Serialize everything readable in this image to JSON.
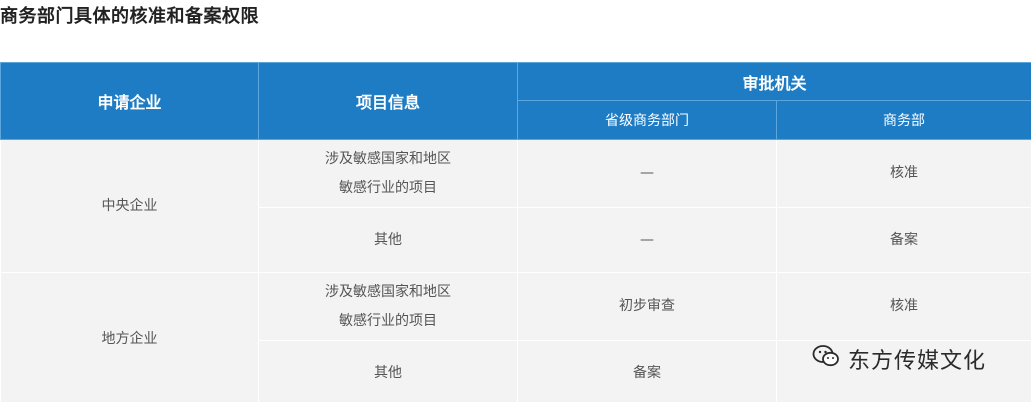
{
  "title": "商务部门具体的核准和备案权限",
  "table": {
    "headers": {
      "company": "申请企业",
      "project_info": "项目信息",
      "authority": "审批机关",
      "provincial": "省级商务部门",
      "ministry": "商务部"
    },
    "groups": [
      {
        "company": "中央企业",
        "rows": [
          {
            "project_lines": [
              "涉及敏感国家和地区",
              "敏感行业的项目"
            ],
            "provincial": "—",
            "ministry": "核准"
          },
          {
            "project_lines": [
              "其他"
            ],
            "provincial": "—",
            "ministry": "备案"
          }
        ]
      },
      {
        "company": "地方企业",
        "rows": [
          {
            "project_lines": [
              "涉及敏感国家和地区",
              "敏感行业的项目"
            ],
            "provincial": "初步审查",
            "ministry": "核准"
          },
          {
            "project_lines": [
              "其他"
            ],
            "provincial": "备案",
            "ministry": ""
          }
        ]
      }
    ]
  },
  "watermark": {
    "text": "东方传媒文化",
    "icon": "wechat-icon"
  }
}
